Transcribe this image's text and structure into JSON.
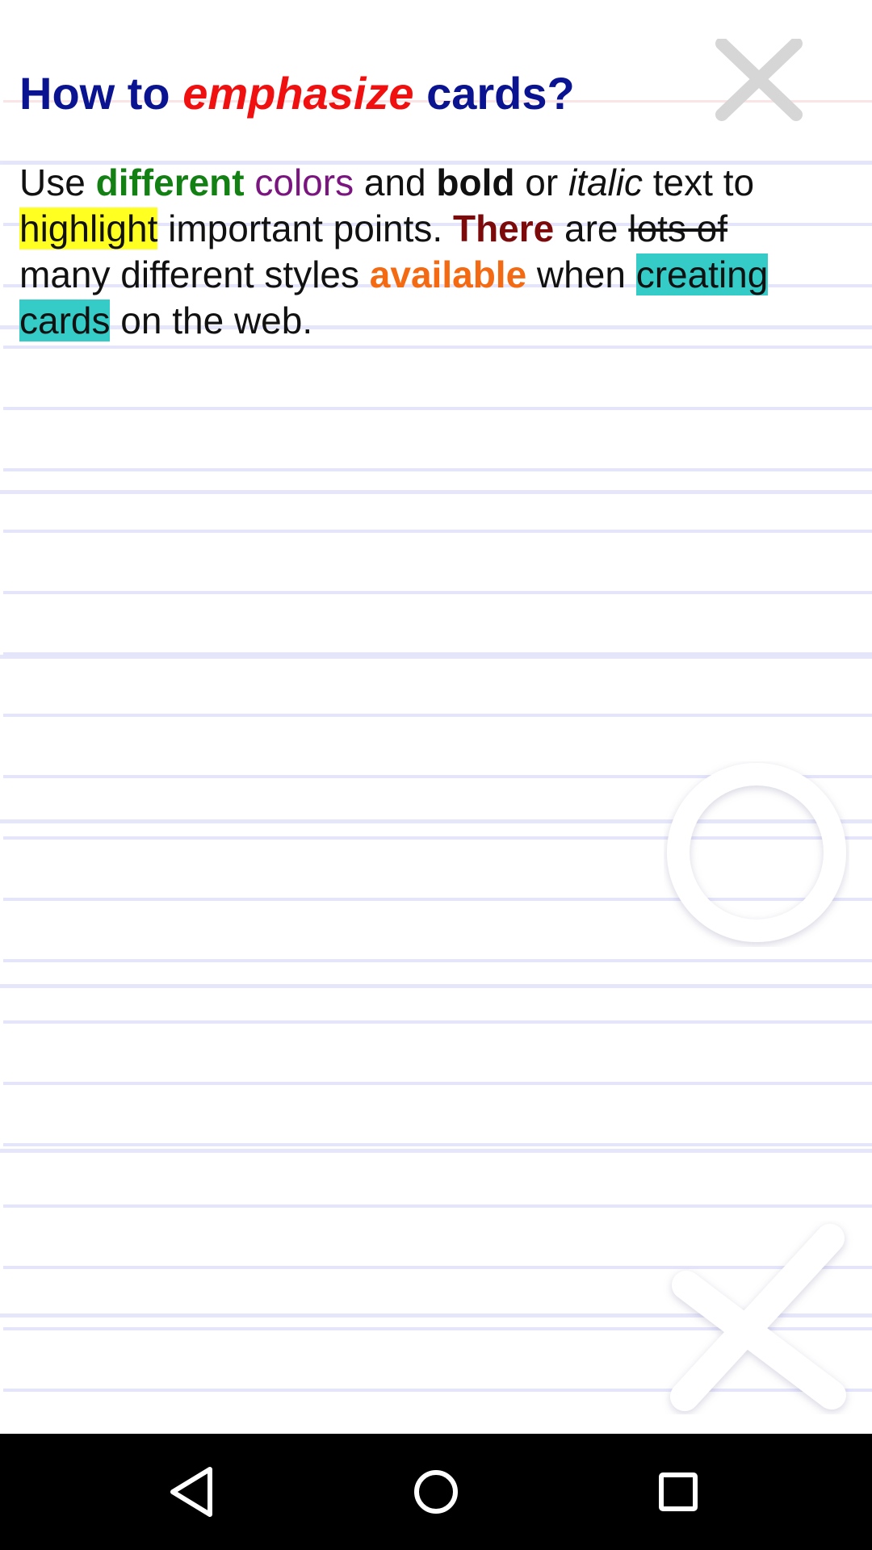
{
  "card": {
    "title": {
      "prefix": "How to ",
      "emphasis": "emphasize",
      "suffix": " cards?"
    },
    "body": [
      {
        "text": "Use ",
        "style": ""
      },
      {
        "text": "different",
        "style": "g"
      },
      {
        "text": " ",
        "style": ""
      },
      {
        "text": "colors",
        "style": "p"
      },
      {
        "text": " and ",
        "style": ""
      },
      {
        "text": "bold",
        "style": "b"
      },
      {
        "text": " or ",
        "style": ""
      },
      {
        "text": "italic",
        "style": "i"
      },
      {
        "text": " text to ",
        "style": ""
      },
      {
        "text": "highlight",
        "style": "hl-y"
      },
      {
        "text": " important points. ",
        "style": ""
      },
      {
        "text": "There",
        "style": "dr"
      },
      {
        "text": " are ",
        "style": ""
      },
      {
        "text": "lots of",
        "style": "st"
      },
      {
        "text": " many different styles ",
        "style": ""
      },
      {
        "text": "available",
        "style": "or"
      },
      {
        "text": " when ",
        "style": ""
      },
      {
        "text": "creating cards",
        "style": "hl-t"
      },
      {
        "text": " on the web.",
        "style": ""
      }
    ]
  },
  "icons": {
    "close_top": "close-icon",
    "circle_answer": "circle-icon",
    "cross_answer": "cross-icon",
    "nav_back": "back-triangle-icon",
    "nav_home": "home-circle-icon",
    "nav_recent": "recent-square-icon"
  },
  "colors": {
    "title": "#0a1490",
    "title_emphasis": "#f01010",
    "green": "#138013",
    "purple": "#7a1580",
    "dark_red": "#7d0a0a",
    "orange": "#f46a12",
    "highlight_yellow": "#ffff22",
    "highlight_teal": "#35cbc7",
    "ruled_line": "#e4e4fb",
    "ruled_line_red": "#fbe4e6",
    "navbar": "#000000"
  }
}
